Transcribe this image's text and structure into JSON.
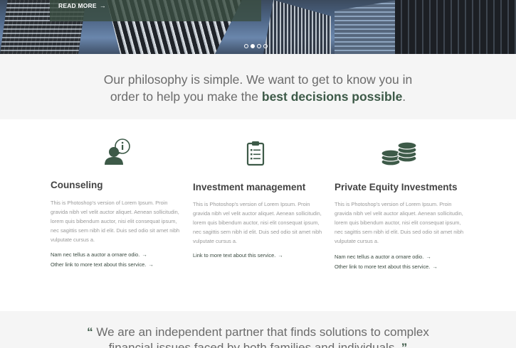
{
  "hero": {
    "cta_label": "READ MORE",
    "cta_arrow": "→",
    "slider_dots": [
      false,
      true,
      false,
      false
    ]
  },
  "philosophy": {
    "line1": "Our philosophy is simple. We want to get to know you in",
    "line2_pre": "order to help you make the ",
    "line2_highlight": "best decisions possible",
    "line2_post": "."
  },
  "services": [
    {
      "icon": "counseling-person-info-icon",
      "title": "Counseling",
      "description": "This is Photoshop's version  of Lorem Ipsum. Proin gravida nibh vel velit auctor aliquet. Aenean sollicitudin, lorem quis bibendum auctor, nisi elit consequat ipsum, nec sagittis sem nibh id elit. Duis sed odio sit amet nibh vulputate cursus a.",
      "links": [
        "Nam nec tellus a auctor a ornare odio.",
        "Other link to more text about this service."
      ]
    },
    {
      "icon": "clipboard-checklist-icon",
      "title": "Investment management",
      "description": "This is Photoshop's version  of Lorem Ipsum. Proin gravida nibh vel velit auctor aliquet. Aenean sollicitudin, lorem quis bibendum auctor, nisi elit consequat ipsum, nec sagittis sem nibh id elit. Duis sed odio sit amet nibh vulputate cursus a.",
      "links": [
        "Link to more text about this service."
      ]
    },
    {
      "icon": "coin-stacks-icon",
      "title": "Private Equity Investments",
      "description": "This is Photoshop's version  of Lorem Ipsum. Proin gravida nibh vel velit auctor aliquet. Aenean sollicitudin, lorem quis bibendum auctor, nisi elit consequat ipsum, nec sagittis sem nibh id elit. Duis sed odio sit amet nibh vulputate cursus a.",
      "links": [
        "Nam nec tellus a auctor a ornare odio.",
        "Other link to more text about this service."
      ]
    }
  ],
  "link_arrow": "→",
  "quote": {
    "open_mark": "“",
    "line1": "We are an independent partner that finds solutions to complex",
    "line2": "financial issues faced by both families and individuals.",
    "close_mark": "”"
  },
  "colors": {
    "accent": "#3d5a48",
    "hero_panel": "#3a4e42",
    "section_bg": "#f5f5f5"
  }
}
